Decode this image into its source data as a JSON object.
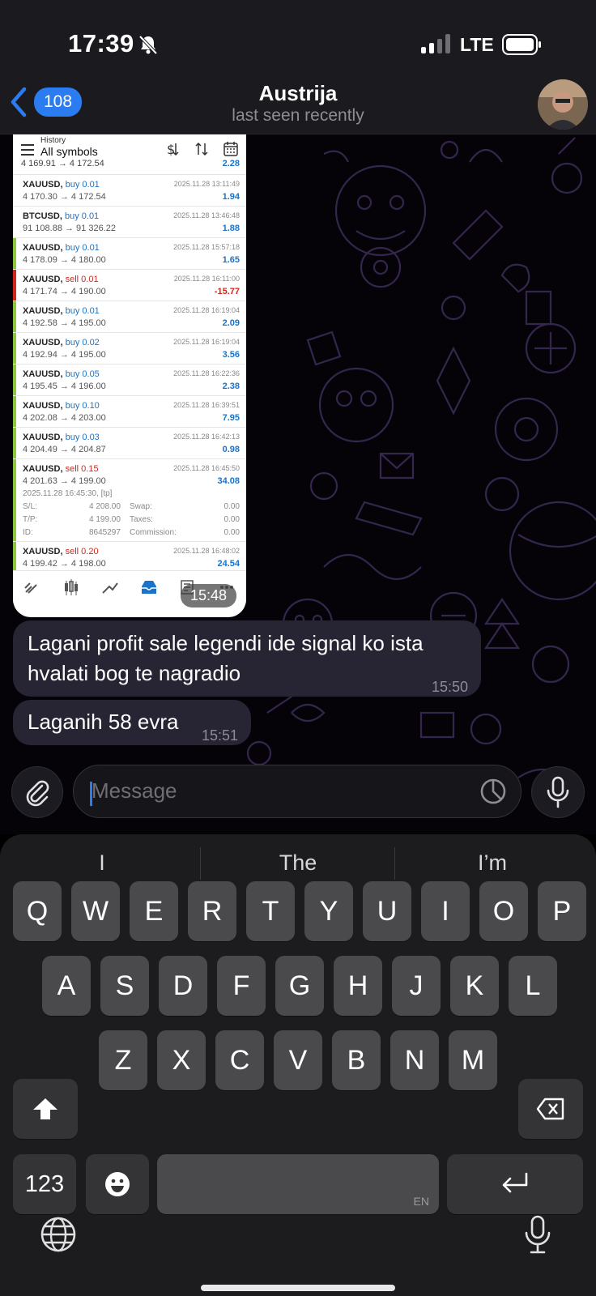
{
  "status_bar": {
    "time": "17:39",
    "network": "LTE"
  },
  "header": {
    "unread_count": "108",
    "contact_name": "Austrija",
    "contact_status": "last seen recently"
  },
  "photo": {
    "history_label": "History",
    "symbols_label": "All symbols",
    "cut_row": {
      "prices": "4 169.91 → 4 172.54",
      "profit": "2.28"
    },
    "trades": [
      {
        "symbol": "XAUUSD,",
        "side": "buy",
        "volume": "0.01",
        "prices": "4 170.30 → 4 172.54",
        "datetime": "2025.11.28 13:11:49",
        "profit": "1.94",
        "bar": "none"
      },
      {
        "symbol": "BTCUSD,",
        "side": "buy",
        "volume": "0.01",
        "prices": "91 108.88 → 91 326.22",
        "datetime": "2025.11.28 13:46:48",
        "profit": "1.88",
        "bar": "none"
      },
      {
        "symbol": "XAUUSD,",
        "side": "buy",
        "volume": "0.01",
        "prices": "4 178.09 → 4 180.00",
        "datetime": "2025.11.28 15:57:18",
        "profit": "1.65",
        "bar": "green"
      },
      {
        "symbol": "XAUUSD,",
        "side": "sell",
        "volume": "0.01",
        "prices": "4 171.74 → 4 190.00",
        "datetime": "2025.11.28 16:11:00",
        "profit": "-15.77",
        "bar": "red"
      },
      {
        "symbol": "XAUUSD,",
        "side": "buy",
        "volume": "0.01",
        "prices": "4 192.58 → 4 195.00",
        "datetime": "2025.11.28 16:19:04",
        "profit": "2.09",
        "bar": "green"
      },
      {
        "symbol": "XAUUSD,",
        "side": "buy",
        "volume": "0.02",
        "prices": "4 192.94 → 4 195.00",
        "datetime": "2025.11.28 16:19:04",
        "profit": "3.56",
        "bar": "green"
      },
      {
        "symbol": "XAUUSD,",
        "side": "buy",
        "volume": "0.05",
        "prices": "4 195.45 → 4 196.00",
        "datetime": "2025.11.28 16:22:36",
        "profit": "2.38",
        "bar": "green"
      },
      {
        "symbol": "XAUUSD,",
        "side": "buy",
        "volume": "0.10",
        "prices": "4 202.08 → 4 203.00",
        "datetime": "2025.11.28 16:39:51",
        "profit": "7.95",
        "bar": "green"
      },
      {
        "symbol": "XAUUSD,",
        "side": "buy",
        "volume": "0.03",
        "prices": "4 204.49 → 4 204.87",
        "datetime": "2025.11.28 16:42:13",
        "profit": "0.98",
        "bar": "green"
      }
    ],
    "expanded_trade": {
      "symbol": "XAUUSD,",
      "side": "sell",
      "volume": "0.15",
      "prices": "4 201.63 → 4 199.00",
      "datetime": "2025.11.28 16:45:50",
      "profit": "34.08",
      "open_line": "2025.11.28 16:45:30, [tp]",
      "sl_label": "S/L:",
      "sl_value": "4 208.00",
      "swap_label": "Swap:",
      "swap_value": "0.00",
      "tp_label": "T/P:",
      "tp_value": "4 199.00",
      "taxes_label": "Taxes:",
      "taxes_value": "0.00",
      "id_label": "ID:",
      "id_value": "8645297",
      "commission_label": "Commission:",
      "commission_value": "0.00"
    },
    "last_trade": {
      "symbol": "XAUUSD,",
      "side": "sell",
      "volume": "0.20",
      "prices": "4 199.42 → 4 198.00",
      "datetime": "2025.11.28 16:48:02",
      "profit": "24.54"
    },
    "time": "15:48"
  },
  "messages": [
    {
      "line1": "Lagani profit sale legendi ide signal ko ista",
      "line2": "hvalati bog te nagradio",
      "time": "15:50"
    },
    {
      "line1": "Laganih 58 evra",
      "time": "15:51"
    }
  ],
  "input": {
    "placeholder": "Message"
  },
  "keyboard": {
    "suggestions": [
      "I",
      "The",
      "I’m"
    ],
    "row1": [
      "Q",
      "W",
      "E",
      "R",
      "T",
      "Y",
      "U",
      "I",
      "O",
      "P"
    ],
    "row2": [
      "A",
      "S",
      "D",
      "F",
      "G",
      "H",
      "J",
      "K",
      "L"
    ],
    "row3": [
      "Z",
      "X",
      "C",
      "V",
      "B",
      "N",
      "M"
    ],
    "numbers_key": "123",
    "space_lang": "EN"
  }
}
